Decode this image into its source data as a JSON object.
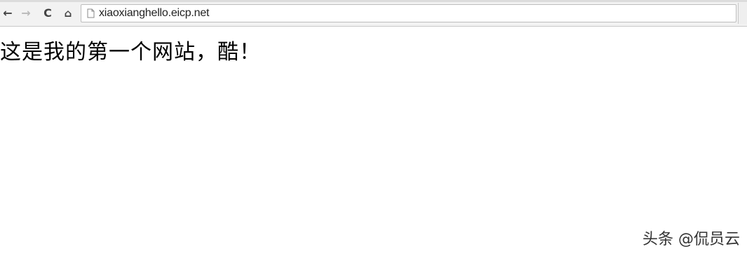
{
  "browser": {
    "nav": {
      "back_icon": "arrow-left-icon",
      "forward_icon": "arrow-right-icon",
      "reload_icon": "reload-icon",
      "home_icon": "home-icon"
    },
    "omnibox": {
      "page_icon": "page-icon",
      "url": "xiaoxianghello.eicp.net"
    }
  },
  "page": {
    "heading": "这是我的第一个网站，酷！"
  },
  "watermark": {
    "text": "头条 @侃员云"
  },
  "colors": {
    "toolbar_bg": "#f2f2f2",
    "page_bg": "#ffffff",
    "text": "#000000"
  }
}
